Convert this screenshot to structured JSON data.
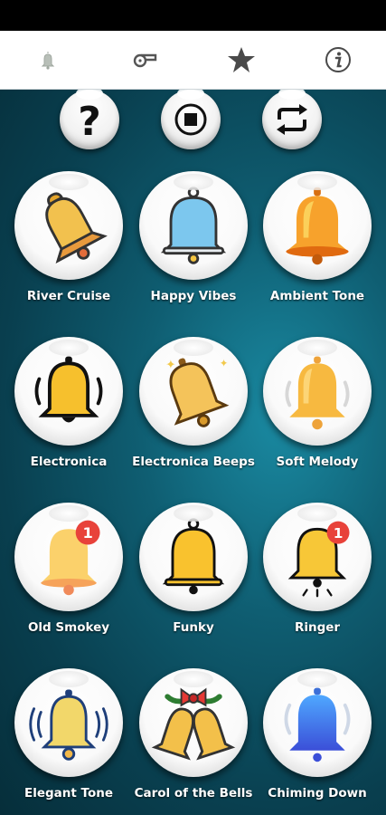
{
  "tabs": [
    {
      "name": "bell-tab",
      "icon": "bell-icon",
      "active": true
    },
    {
      "name": "whistle-tab",
      "icon": "whistle-icon"
    },
    {
      "name": "favorites-tab",
      "icon": "star-icon"
    },
    {
      "name": "info-tab",
      "icon": "info-icon"
    }
  ],
  "controls": [
    {
      "icon": "help-icon"
    },
    {
      "icon": "stop-icon"
    },
    {
      "icon": "repeat-icon"
    }
  ],
  "sounds": [
    {
      "label": "River Cruise",
      "icon": "gold-bell-icon"
    },
    {
      "label": "Happy Vibes",
      "icon": "blue-bell-icon"
    },
    {
      "label": "Ambient Tone",
      "icon": "orange-bell-icon"
    },
    {
      "label": "Electronica",
      "icon": "ringing-bell-icon"
    },
    {
      "label": "Electronica Beeps",
      "icon": "sparkle-bell-icon"
    },
    {
      "label": "Soft Melody",
      "icon": "soft-bell-icon"
    },
    {
      "label": "Old Smokey",
      "icon": "notification-bell-icon",
      "badge": "1"
    },
    {
      "label": "Funky",
      "icon": "yellow-bell-icon"
    },
    {
      "label": "Ringer",
      "icon": "notification-ringing-bell-icon",
      "badge": "1"
    },
    {
      "label": "Elegant Tone",
      "icon": "vibrating-bell-icon"
    },
    {
      "label": "Carol of the Bells",
      "icon": "christmas-bells-icon"
    },
    {
      "label": "Chiming Down",
      "icon": "blue-ringing-bell-icon"
    }
  ],
  "badges": [
    "1",
    "1"
  ]
}
